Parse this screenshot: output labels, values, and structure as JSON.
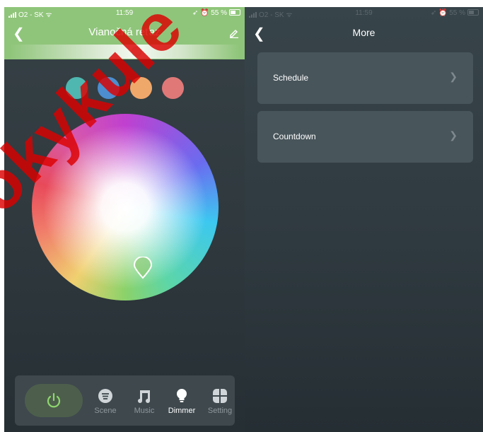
{
  "left_screen": {
    "status_bar": {
      "carrier": "O2 - SK",
      "time": "11:59",
      "battery": "55 %"
    },
    "header": {
      "title": "Vianočná reťaz"
    },
    "preset_colors": [
      "#4fb6b0",
      "#4c8ed0",
      "#f0a86a",
      "#e07878"
    ],
    "brightness": 0.55,
    "tab_bar": {
      "tabs": [
        {
          "label": "Scene",
          "icon": "scene-icon"
        },
        {
          "label": "Music",
          "icon": "music-icon"
        },
        {
          "label": "Dimmer",
          "icon": "bulb-icon",
          "active": true
        },
        {
          "label": "Setting",
          "icon": "grid-icon"
        }
      ]
    }
  },
  "right_screen": {
    "status_bar": {
      "carrier": "O2 - SK",
      "time": "11:59",
      "battery": "55 %"
    },
    "header": {
      "title": "More"
    },
    "menu_items": [
      {
        "label": "Schedule"
      },
      {
        "label": "Countdown"
      }
    ]
  },
  "colors": {
    "accent_green": "#8fc57a",
    "panel": "#3e484d",
    "row": "#48555b"
  },
  "watermark": "okykule"
}
